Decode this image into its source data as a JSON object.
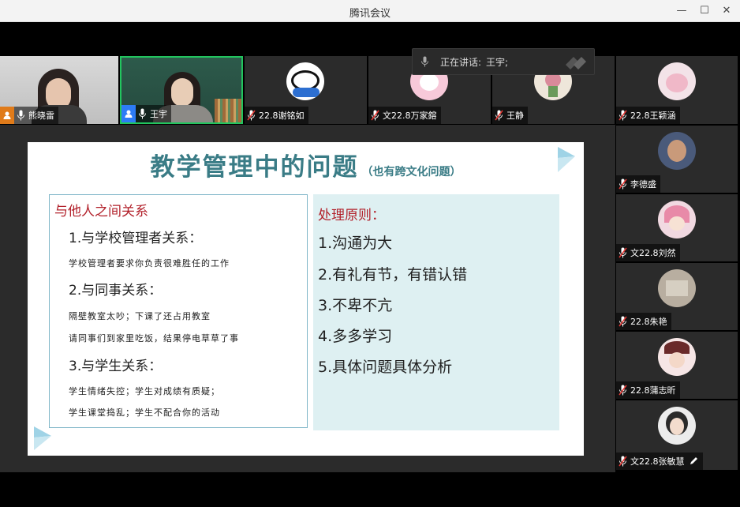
{
  "window": {
    "title": "腾讯会议"
  },
  "speaking": {
    "label": "正在讲话:",
    "name": "王宇;"
  },
  "top_tiles": [
    {
      "name": "熊晓雷"
    },
    {
      "name": "王宇"
    },
    {
      "name": "22.8谢铭如"
    },
    {
      "name": "文22.8万家鎔"
    },
    {
      "name": "王静"
    },
    {
      "name": "22.8王颖涵"
    }
  ],
  "side_tiles": [
    {
      "name": "李德盛"
    },
    {
      "name": "文22.8刘然"
    },
    {
      "name": "22.8朱艳"
    },
    {
      "name": "22.8蒲志昕"
    },
    {
      "name": "文22.8张敏慧"
    }
  ],
  "slide": {
    "title": "教学管理中的问题",
    "subtitle": "（也有跨文化问题）",
    "left": {
      "heading": "与他人之间关系",
      "s1": "1.与学校管理者关系：",
      "s1_l1": "学校管理者要求你负责很难胜任的工作",
      "s2": "2.与同事关系：",
      "s2_l1": "隔壁教室太吵；下课了还占用教室",
      "s2_l2": "请同事们到家里吃饭，结果停电草草了事",
      "s3": "3.与学生关系：",
      "s3_l1": "学生情绪失控；学生对成绩有质疑；",
      "s3_l2": "学生课堂捣乱；学生不配合你的活动"
    },
    "right": {
      "heading": "处理原则：",
      "items": [
        "1.沟通为大",
        "2.有礼有节，有错认错",
        "3.不卑不亢",
        "4.多多学习",
        "5.具体问题具体分析"
      ]
    }
  },
  "colors": {
    "title_teal": "#3a7c86",
    "heading_red": "#b2202a",
    "active_border": "#22c55e",
    "right_box": "#def0f2"
  }
}
